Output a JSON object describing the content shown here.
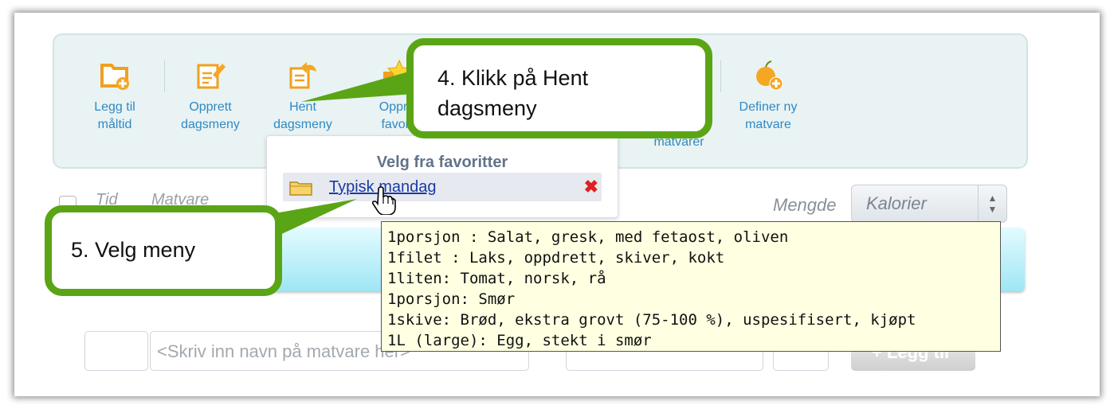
{
  "toolbar": {
    "items": [
      {
        "label": "Legg til\nmåltid",
        "icon": "add-meal-icon"
      },
      {
        "label": "Opprett\ndagsmeny",
        "icon": "create-menu-icon"
      },
      {
        "label": "Hent\ndagsmeny",
        "icon": "fetch-menu-icon"
      },
      {
        "label": "Oppre\nfavori",
        "icon": "favorite-star-icon"
      },
      {
        "label": "Definer ny\nmatvare",
        "icon": "define-food-icon"
      }
    ],
    "hidden_label": "matvarer"
  },
  "table_header": {
    "tid": "Tid",
    "matvare": "Matvare",
    "mengde": "Mengde"
  },
  "kalorier_select": {
    "value": "Kalorier"
  },
  "favorites_popup": {
    "title": "Velg fra favoritter",
    "item_label": "Typisk mandag"
  },
  "tooltip": {
    "lines": [
      "1porsjon : Salat, gresk, med fetaost, oliven",
      "1filet : Laks, oppdrett, skiver, kokt",
      "1liten: Tomat, norsk, rå",
      "1porsjon: Smør",
      "1skive: Brød, ekstra grovt (75-100 %), uspesifisert, kjøpt",
      "1L (large): Egg, stekt i smør"
    ]
  },
  "add_form": {
    "food_placeholder": "<Skriv inn navn på matvare her>",
    "add_button_label": "+ Legg til"
  },
  "callouts": {
    "step4": "4. Klikk på Hent\ndagsmeny",
    "step5": "5. Velg meny"
  },
  "colors": {
    "accent_green": "#5aa515",
    "link_blue": "#2f89c6",
    "tooltip_bg": "#ffffe2",
    "delete_red": "#e02020"
  }
}
